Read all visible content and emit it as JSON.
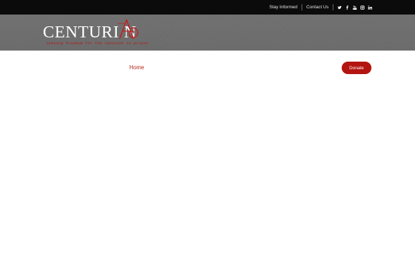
{
  "topbar": {
    "links": [
      "Stay Informed",
      "Contact Us"
    ],
    "social_icons": [
      "twitter-icon",
      "facebook-icon",
      "youtube-icon",
      "instagram-icon",
      "linkedin-icon"
    ]
  },
  "logo": {
    "wordmark": "CENTURI N",
    "tagline": "seeking freedom for the innocent in prison"
  },
  "nav": {
    "home_label": "Home",
    "donate_label": "Donate"
  },
  "colors": {
    "topbar_bg": "#0b0b0b",
    "header_bg": "#6d6d6d",
    "accent_red": "#b3140f",
    "nav_link": "#b5261e"
  }
}
